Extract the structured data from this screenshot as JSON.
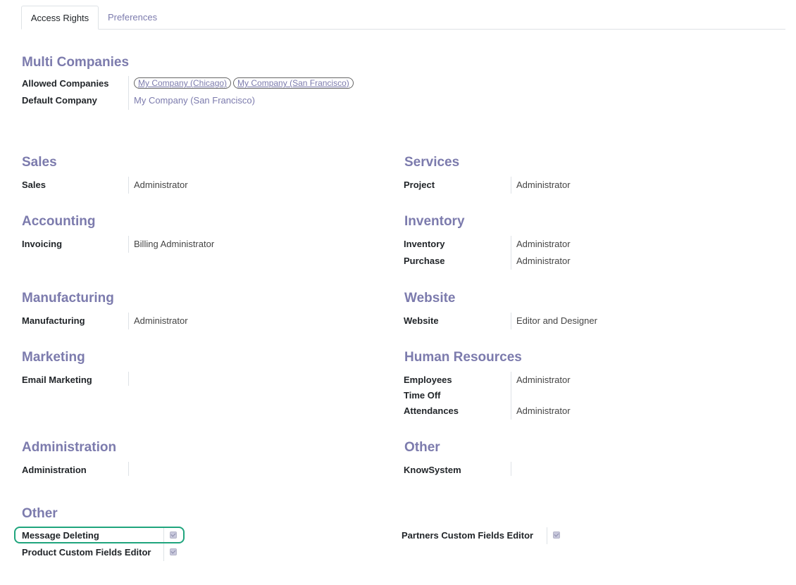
{
  "tabs": [
    {
      "label": "Access Rights",
      "active": true
    },
    {
      "label": "Preferences",
      "active": false
    }
  ],
  "multi_companies": {
    "title": "Multi Companies",
    "allowed_label": "Allowed Companies",
    "allowed_tags": [
      "My Company (Chicago)",
      "My Company (San Francisco)"
    ],
    "default_label": "Default Company",
    "default_value": "My Company (San Francisco)"
  },
  "sales": {
    "title": "Sales",
    "rows": [
      {
        "label": "Sales",
        "value": "Administrator"
      }
    ]
  },
  "services": {
    "title": "Services",
    "rows": [
      {
        "label": "Project",
        "value": "Administrator"
      }
    ]
  },
  "accounting": {
    "title": "Accounting",
    "rows": [
      {
        "label": "Invoicing",
        "value": "Billing Administrator"
      }
    ]
  },
  "inventory": {
    "title": "Inventory",
    "rows": [
      {
        "label": "Inventory",
        "value": "Administrator"
      },
      {
        "label": "Purchase",
        "value": "Administrator"
      }
    ]
  },
  "manufacturing": {
    "title": "Manufacturing",
    "rows": [
      {
        "label": "Manufacturing",
        "value": "Administrator"
      }
    ]
  },
  "website": {
    "title": "Website",
    "rows": [
      {
        "label": "Website",
        "value": "Editor and Designer"
      }
    ]
  },
  "marketing": {
    "title": "Marketing",
    "rows": [
      {
        "label": "Email Marketing",
        "value": ""
      }
    ]
  },
  "human_resources": {
    "title": "Human Resources",
    "rows": [
      {
        "label": "Employees",
        "value": "Administrator"
      },
      {
        "label": "Time Off",
        "value": ""
      },
      {
        "label": "Attendances",
        "value": "Administrator"
      }
    ]
  },
  "administration": {
    "title": "Administration",
    "rows": [
      {
        "label": "Administration",
        "value": ""
      }
    ]
  },
  "other_right": {
    "title": "Other",
    "rows": [
      {
        "label": "KnowSystem",
        "value": ""
      }
    ]
  },
  "other_bottom": {
    "title": "Other",
    "message_deleting": "Message Deleting",
    "product_custom_fields": "Product Custom Fields Editor",
    "partners_custom_fields": "Partners Custom Fields Editor"
  },
  "colors": {
    "accent": "#7c7bad",
    "highlight": "#1fa57d"
  }
}
